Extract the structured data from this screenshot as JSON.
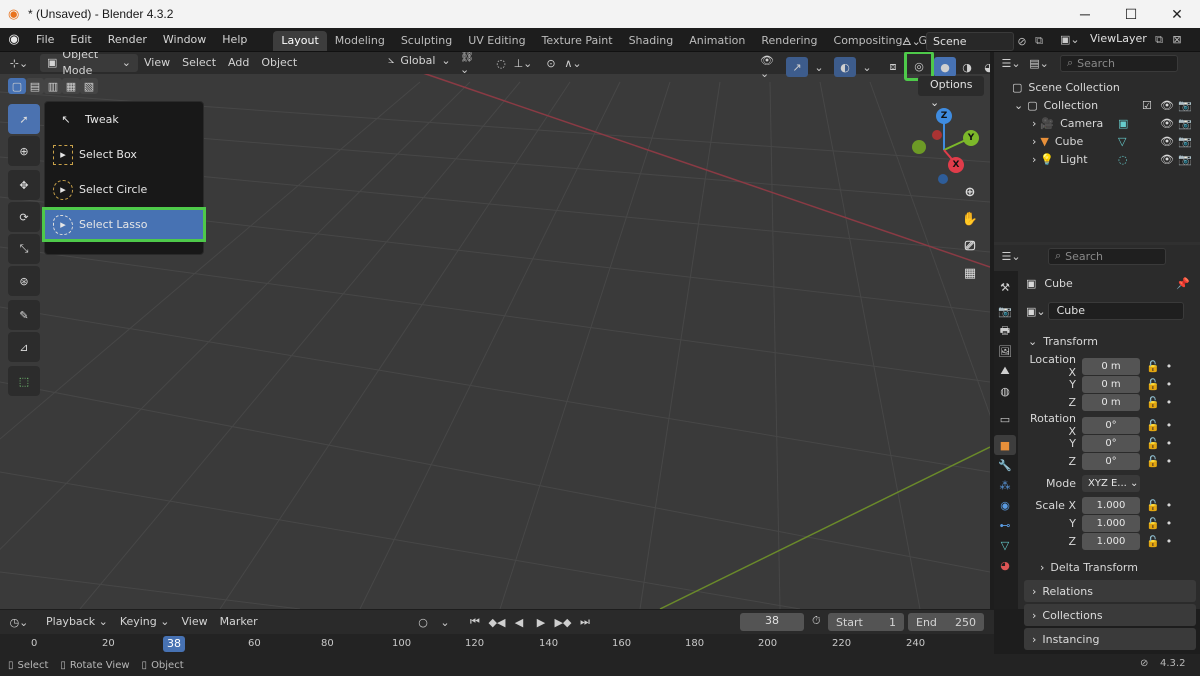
{
  "window": {
    "title": "* (Unsaved) - Blender 4.3.2",
    "min": "─",
    "max": "☐",
    "close": "✕"
  },
  "menu": [
    "File",
    "Edit",
    "Render",
    "Window",
    "Help"
  ],
  "workspaces": [
    "Layout",
    "Modeling",
    "Sculpting",
    "UV Editing",
    "Texture Paint",
    "Shading",
    "Animation",
    "Rendering",
    "Compositing",
    "Geometry No"
  ],
  "active_workspace": "Layout",
  "scene": "Scene",
  "view_layer": "ViewLayer",
  "viewport_header": {
    "mode": "Object Mode",
    "menus": [
      "View",
      "Select",
      "Add",
      "Object"
    ],
    "orientation": "Global",
    "options": "Options"
  },
  "tool_popup": {
    "items": [
      "Tweak",
      "Select Box",
      "Select Circle",
      "Select Lasso"
    ],
    "highlighted": "Select Lasso"
  },
  "gizmo": {
    "z": "Z",
    "y": "Y",
    "x": "X"
  },
  "outliner": {
    "search_placeholder": "Search",
    "root": "Scene Collection",
    "collection": "Collection",
    "objects": [
      "Camera",
      "Cube",
      "Light"
    ]
  },
  "properties": {
    "search_placeholder": "Search",
    "object_name": "Cube",
    "data_name": "Cube",
    "transform_label": "Transform",
    "location": {
      "label_x": "Location X",
      "label_y": "Y",
      "label_z": "Z",
      "x": "0 m",
      "y": "0 m",
      "z": "0 m"
    },
    "rotation": {
      "label_x": "Rotation X",
      "label_y": "Y",
      "label_z": "Z",
      "x": "0°",
      "y": "0°",
      "z": "0°"
    },
    "mode_label": "Mode",
    "mode_value": "XYZ E...",
    "scale": {
      "label_x": "Scale X",
      "label_y": "Y",
      "label_z": "Z",
      "x": "1.000",
      "y": "1.000",
      "z": "1.000"
    },
    "panels": [
      "Delta Transform",
      "Relations",
      "Collections",
      "Instancing"
    ]
  },
  "timeline": {
    "menus": [
      "Playback",
      "Keying",
      "View",
      "Marker"
    ],
    "current_frame": "38",
    "start_label": "Start",
    "start": "1",
    "end_label": "End",
    "end": "250",
    "ticks": [
      "0",
      "20",
      "38",
      "60",
      "80",
      "100",
      "120",
      "140",
      "160",
      "180",
      "200",
      "220",
      "240"
    ]
  },
  "status": {
    "select": "Select",
    "rotate": "Rotate View",
    "object": "Object",
    "version": "4.3.2"
  },
  "colors": {
    "accent": "#4772b3",
    "highlight_box": "#4ec94a",
    "x_axis": "#e03c4a",
    "y_axis": "#7cb82a",
    "z_axis": "#3f8ce0"
  }
}
